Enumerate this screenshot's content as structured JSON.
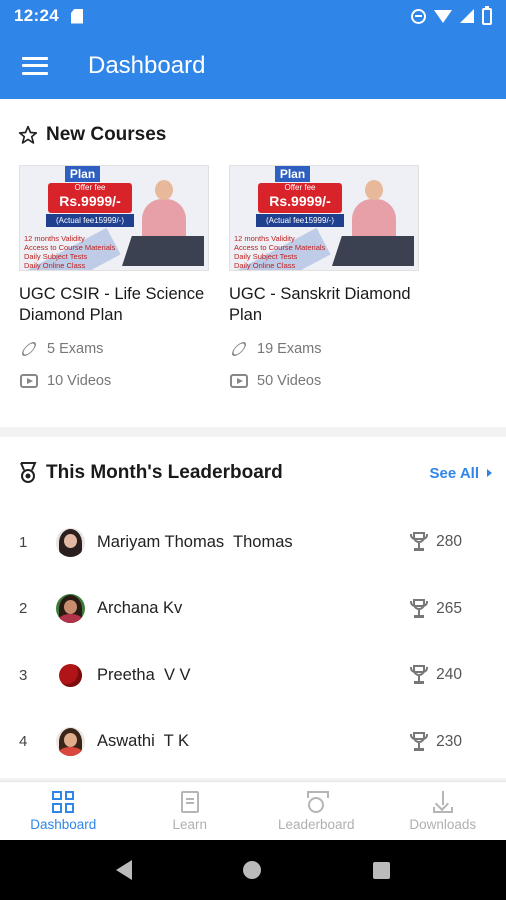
{
  "status_bar": {
    "time": "12:24"
  },
  "app_bar": {
    "title": "Dashboard"
  },
  "new_courses": {
    "title": "New Courses",
    "items": [
      {
        "title": "UGC CSIR - Life Science Diamond Plan",
        "exams": "5 Exams",
        "videos": "10 Videos",
        "thumb": {
          "plan": "Plan",
          "offer": "Offer fee",
          "price": "Rs.9999/-",
          "actual": "(Actual fee15999/-)",
          "lines": [
            "12 months Validity",
            "Access to Course Materials",
            "Daily Subject Tests",
            "Daily Online Class"
          ]
        }
      },
      {
        "title": "UGC - Sanskrit Diamond Plan",
        "exams": "19 Exams",
        "videos": "50 Videos",
        "thumb": {
          "plan": "Plan",
          "offer": "Offer fee",
          "price": "Rs.9999/-",
          "actual": "(Actual fee15999/-)",
          "lines": [
            "12 months Validity",
            "Access to Course Materials",
            "Daily Subject Tests",
            "Daily Online Class"
          ]
        }
      }
    ]
  },
  "leaderboard": {
    "title": "This Month's Leaderboard",
    "see_all": "See All",
    "rows": [
      {
        "rank": "1",
        "name": "Mariyam Thomas  Thomas",
        "score": "280"
      },
      {
        "rank": "2",
        "name": "Archana Kv",
        "score": "265"
      },
      {
        "rank": "3",
        "name": "Preetha  V V",
        "score": "240"
      },
      {
        "rank": "4",
        "name": "Aswathi  T K",
        "score": "230"
      }
    ]
  },
  "bottom_nav": {
    "items": [
      {
        "label": "Dashboard",
        "active": true
      },
      {
        "label": "Learn"
      },
      {
        "label": "Leaderboard"
      },
      {
        "label": "Downloads"
      }
    ]
  },
  "colors": {
    "primary": "#2f86e8",
    "inactive": "#b0b0b0"
  }
}
